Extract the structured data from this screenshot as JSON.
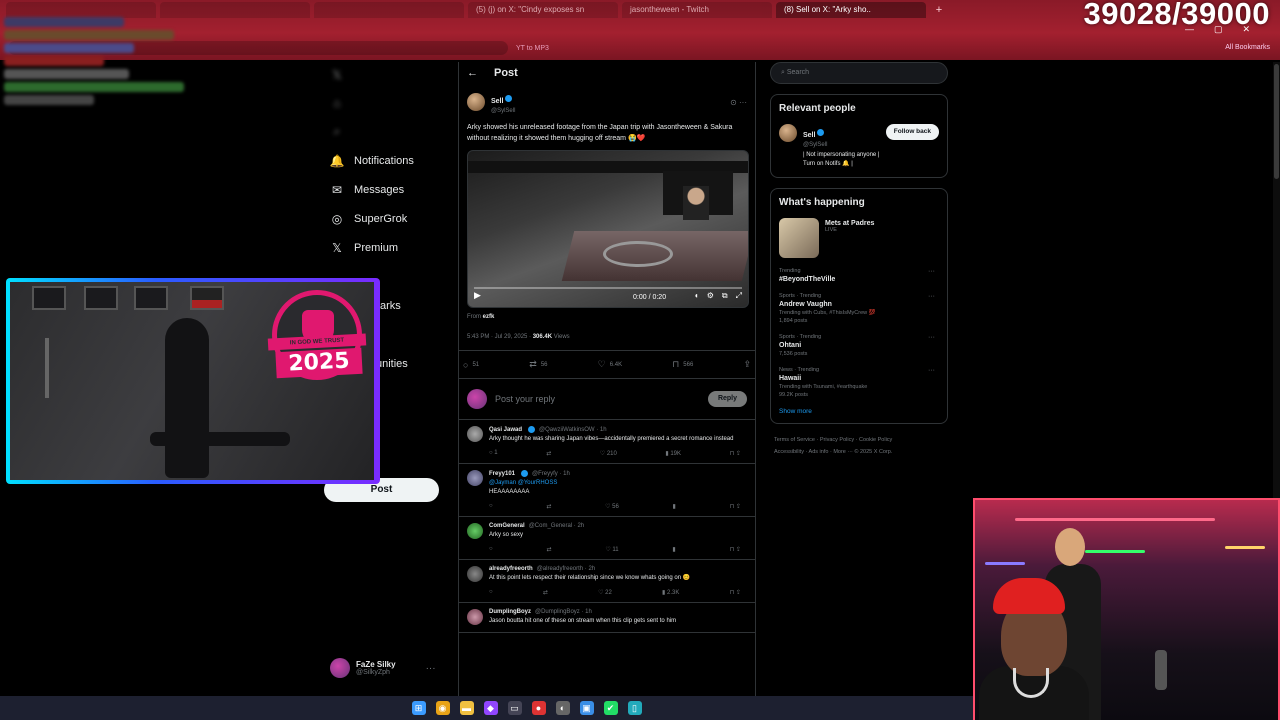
{
  "browser": {
    "tabs": [
      {
        "label": "",
        "active": false
      },
      {
        "label": "",
        "active": false
      },
      {
        "label": "",
        "active": false
      },
      {
        "label": "(5) (j) on X: \"Cindy exposes sn",
        "active": false
      },
      {
        "label": "jasontheween - Twitch",
        "active": false
      },
      {
        "label": "(8) Sell on X: \"Arky sho..",
        "active": true
      }
    ],
    "new_tab": "+",
    "bookmark_left": "YT to MP3",
    "bookmark_right": "All Bookmarks",
    "window_controls": [
      "—",
      "▢",
      "✕"
    ]
  },
  "overlay": {
    "counter": "39028/39000"
  },
  "sidebar": {
    "items": [
      {
        "label": "Notifications",
        "icon": "bell-icon",
        "glyph": "🔔"
      },
      {
        "label": "Messages",
        "icon": "envelope-icon",
        "glyph": "✉"
      },
      {
        "label": "SuperGrok",
        "icon": "grok-icon",
        "glyph": "◎"
      },
      {
        "label": "Premium",
        "icon": "x-logo-icon",
        "glyph": "𝕏"
      }
    ],
    "partial_labels": [
      "arks",
      "unities"
    ],
    "post_button": "Post",
    "account": {
      "name": "FaZe Silky",
      "handle": "@SilkyZph",
      "more": "···"
    }
  },
  "main": {
    "header": "Post",
    "back": "←",
    "op": {
      "name": "Sell",
      "handle": "@SylSell",
      "text": "Arky showed his unreleased footage from the Japan trip with Jasontheween & Sakura without realizing it showed them hugging off stream 😭❤️",
      "video_time": "0:00 / 0:20",
      "video_progress": 0.0,
      "from_label": "From",
      "from_name": "ezfk",
      "time": "5:43 PM · Jul 29, 2025 ·",
      "views": "306.4K",
      "views_label": "Views"
    },
    "stats": [
      {
        "icon": "reply-icon",
        "glyph": "💬",
        "value": "51"
      },
      {
        "icon": "repost-icon",
        "glyph": "⇄",
        "value": "56"
      },
      {
        "icon": "like-icon",
        "glyph": "♡",
        "value": "6.4K"
      },
      {
        "icon": "bookmark-icon",
        "glyph": "🔖",
        "value": "566"
      },
      {
        "icon": "share-icon",
        "glyph": "⇪",
        "value": ""
      }
    ],
    "reply_placeholder": "Post your reply",
    "reply_button": "Reply",
    "replies": [
      {
        "name": "Qasi Jawad",
        "handle": "@QawziiWatkinsOW · 1h",
        "text": "Arky thought he was sharing Japan vibes—accidentally premiered a secret romance instead",
        "link": "",
        "counts": [
          "1",
          "",
          "210",
          "19K",
          ""
        ]
      },
      {
        "name": "Freyy101",
        "handle": "@Freyyfy · 1h",
        "text": "HEAAAAAAAA",
        "link": "@Jayman @YourRHOSS",
        "counts": [
          "",
          "",
          "56",
          "",
          ""
        ]
      },
      {
        "name": "ComGeneral",
        "handle": "@Com_General · 2h",
        "text": "Arky so sexy",
        "link": "",
        "counts": [
          "",
          "",
          "11",
          "",
          ""
        ]
      },
      {
        "name": "alreadyfreeorth",
        "handle": "@alreadyfreeorth · 2h",
        "text": "At this point lets respect their relationship since we know whats going on 😊",
        "link": "",
        "counts": [
          "",
          "",
          "22",
          "2.3K",
          ""
        ]
      },
      {
        "name": "DumplingBoyz",
        "handle": "@DumplingBoyz · 1h",
        "text": "Jason boutta hit one of these on stream when this clip gets sent to him",
        "link": "",
        "counts": [
          "",
          "",
          "",
          "",
          ""
        ]
      }
    ]
  },
  "right": {
    "search_placeholder": "Search",
    "relevant_title": "Relevant people",
    "person": {
      "name": "Sell",
      "handle": "@SylSell",
      "follow": "Follow back",
      "bio": "| Not impersonating anyone | Turn on Notifs 🔔 |"
    },
    "happening_title": "What's happening",
    "event": {
      "name": "Mets at Padres",
      "status": "LIVE"
    },
    "trends": [
      {
        "category": "Trending",
        "name": "#BeyondTheVille",
        "sub": ""
      },
      {
        "category": "Sports · Trending",
        "name": "Andrew Vaughn",
        "sub": "Trending with Cubs, #ThisIsMyCrew 💯",
        "extra": "1,894 posts"
      },
      {
        "category": "Sports · Trending",
        "name": "Ohtani",
        "sub": "",
        "extra": "7,536 posts"
      },
      {
        "category": "News · Trending",
        "name": "Hawaii",
        "sub": "Trending with Tsunami, #earthquake",
        "extra": "99.2K posts"
      }
    ],
    "show_more": "Show more",
    "footer": [
      "Terms of Service",
      "Privacy Policy",
      "Cookie Policy",
      "Accessibility",
      "Ads info",
      "More ···",
      "© 2025 X Corp."
    ]
  },
  "webcam": {
    "badge_banner": "IN GOD WE TRUST",
    "badge_year": "2025"
  },
  "taskbar": {
    "icons": [
      {
        "name": "start-icon",
        "glyph": "⊞",
        "color": "#3b9bff"
      },
      {
        "name": "chrome-icon",
        "glyph": "◉",
        "color": "#e8a317"
      },
      {
        "name": "folder-icon",
        "glyph": "▬",
        "color": "#f0c040"
      },
      {
        "name": "stream-app-icon",
        "glyph": "◆",
        "color": "#9146ff"
      },
      {
        "name": "terminal-icon",
        "glyph": "▭",
        "color": "#445"
      },
      {
        "name": "record-icon",
        "glyph": "●",
        "color": "#d33"
      },
      {
        "name": "obs-icon",
        "glyph": "◐",
        "color": "#666"
      },
      {
        "name": "photos-icon",
        "glyph": "▣",
        "color": "#3a8ee6"
      },
      {
        "name": "check-icon",
        "glyph": "✔",
        "color": "#2d6"
      },
      {
        "name": "phone-icon",
        "glyph": "▯",
        "color": "#2ab"
      }
    ]
  }
}
